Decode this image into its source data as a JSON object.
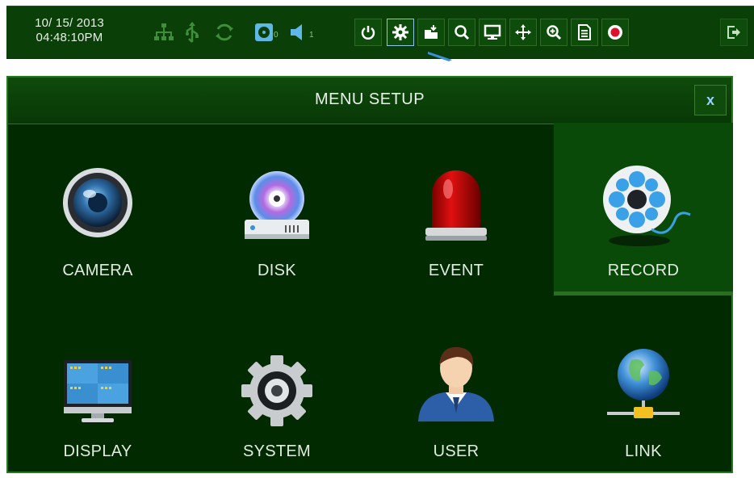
{
  "toolbar": {
    "date": "10/ 15/ 2013",
    "time": "04:48:10PM",
    "disk_count": "0",
    "audio_count": "1",
    "buttons": [
      {
        "name": "power-icon"
      },
      {
        "name": "gear-icon"
      },
      {
        "name": "backup-icon"
      },
      {
        "name": "search-icon"
      },
      {
        "name": "monitor-icon"
      },
      {
        "name": "move-icon"
      },
      {
        "name": "zoom-icon"
      },
      {
        "name": "log-icon"
      },
      {
        "name": "record-icon"
      }
    ]
  },
  "dialog": {
    "title": "MENU SETUP",
    "close_label": "x",
    "items": [
      {
        "label": "CAMERA",
        "icon": "camera-lens-icon"
      },
      {
        "label": "DISK",
        "icon": "disk-icon"
      },
      {
        "label": "EVENT",
        "icon": "alarm-light-icon"
      },
      {
        "label": "RECORD",
        "icon": "film-reel-icon",
        "selected": true
      },
      {
        "label": "DISPLAY",
        "icon": "display-monitor-icon"
      },
      {
        "label": "SYSTEM",
        "icon": "system-gear-icon"
      },
      {
        "label": "USER",
        "icon": "user-icon"
      },
      {
        "label": "LINK",
        "icon": "network-globe-icon"
      }
    ]
  },
  "colors": {
    "background": "#012a01",
    "toolbar": "#0a3f08",
    "accent_border": "#237a1c",
    "selected_tile": "#0a4a08",
    "text": "#e2ebe2"
  }
}
